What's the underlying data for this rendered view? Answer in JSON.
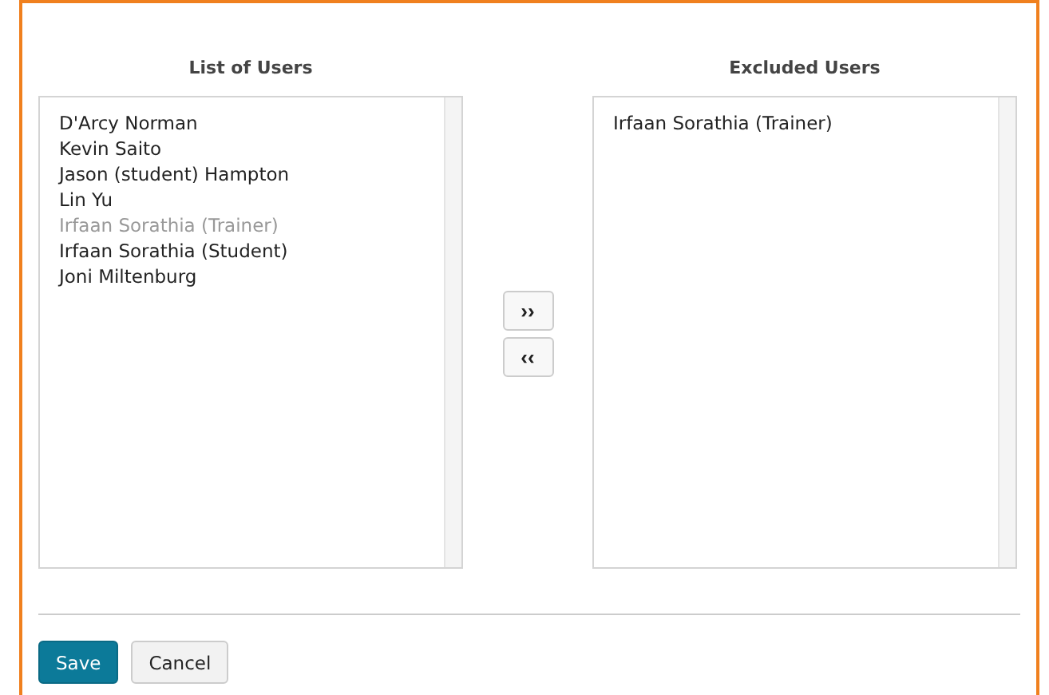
{
  "available": {
    "title": "List of Users",
    "items": [
      {
        "label": "D'Arcy Norman",
        "disabled": false
      },
      {
        "label": "Kevin Saito",
        "disabled": false
      },
      {
        "label": "Jason (student) Hampton",
        "disabled": false
      },
      {
        "label": "Lin Yu",
        "disabled": false
      },
      {
        "label": "Irfaan Sorathia (Trainer)",
        "disabled": true
      },
      {
        "label": "Irfaan Sorathia (Student)",
        "disabled": false
      },
      {
        "label": "Joni Miltenburg",
        "disabled": false
      }
    ]
  },
  "move_buttons": [
    "››",
    "‹‹"
  ],
  "excluded": {
    "title": "Excluded Users",
    "items": [
      {
        "label": "Irfaan Sorathia (Trainer)",
        "disabled": false
      }
    ]
  },
  "buttons": [
    {
      "label": "Save",
      "kind": "primary"
    },
    {
      "label": "Cancel",
      "kind": "secondary"
    }
  ]
}
